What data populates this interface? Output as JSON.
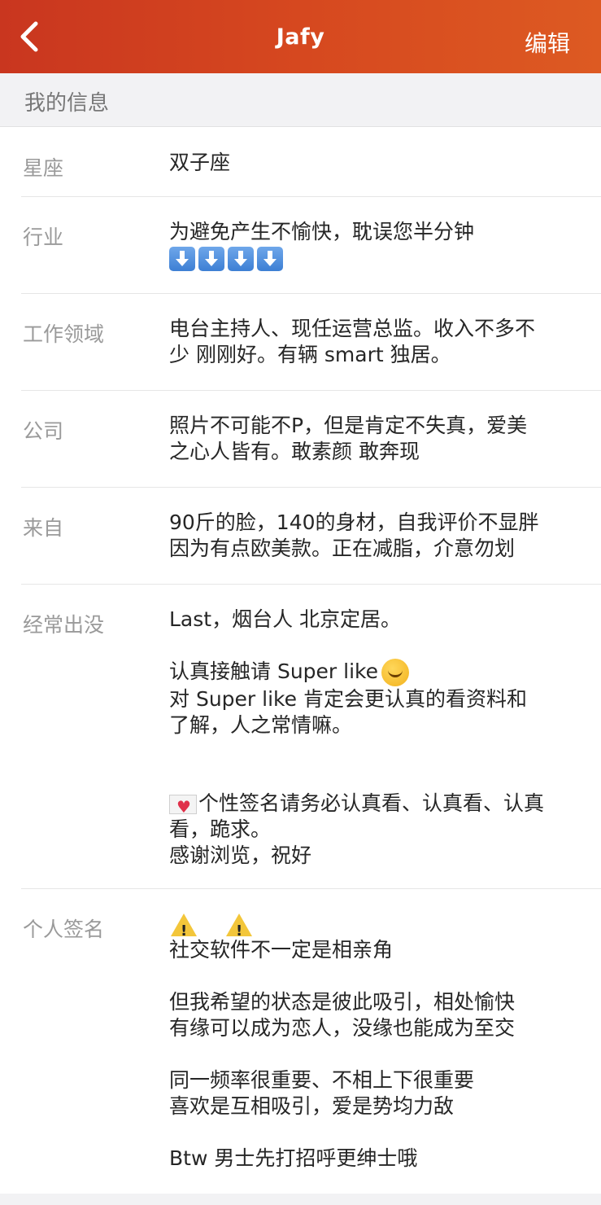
{
  "navbar": {
    "back_icon": "chevron-left-icon",
    "title": "Jafy",
    "edit_label": "编辑",
    "colors": {
      "bg_start": "#c9361f",
      "bg_end": "#dd5a22",
      "text": "#ffffff"
    }
  },
  "section": {
    "title": "我的信息"
  },
  "fields": {
    "constellation": {
      "label": "星座",
      "lines": [
        "双子座"
      ]
    },
    "industry": {
      "label": "行业",
      "lines": [
        "为避免产生不愉快，耽误您半分钟"
      ],
      "emoji": "down-arrow-icon"
    },
    "work_area": {
      "label": "工作领域",
      "lines": [
        "电台主持人、现任运营总监。收入不多不",
        "少 刚刚好。有辆 smart 独居。"
      ]
    },
    "company": {
      "label": "公司",
      "lines": [
        "照片不可能不P，但是肯定不失真，爱美",
        "之心人皆有。敢素颜 敢奔现"
      ]
    },
    "from": {
      "label": "来自",
      "lines": [
        "90斤的脸，140的身材，自我评价不显胖",
        "因为有点欧美款。正在减脂，介意勿划"
      ]
    },
    "frequent": {
      "label": "经常出没",
      "lines": [
        "Last，烟台人 北京定居。",
        "认真接触请 Super like",
        "对 Super like 肯定会更认真的看资料和",
        "了解，人之常情嘛。",
        "个性签名请务必认真看、认真看、认真",
        "看，跪求。",
        "感谢浏览，祝好"
      ]
    },
    "signature": {
      "label": "个人签名",
      "lines": [
        "社交软件不一定是相亲角",
        "但我希望的状态是彼此吸引，相处愉快",
        "有缘可以成为恋人，没缘也能成为至交",
        "同一频率很重要、不相上下很重要",
        "喜欢是互相吸引，爱是势均力敌",
        "Btw 男士先打招呼更绅士哦"
      ]
    }
  }
}
